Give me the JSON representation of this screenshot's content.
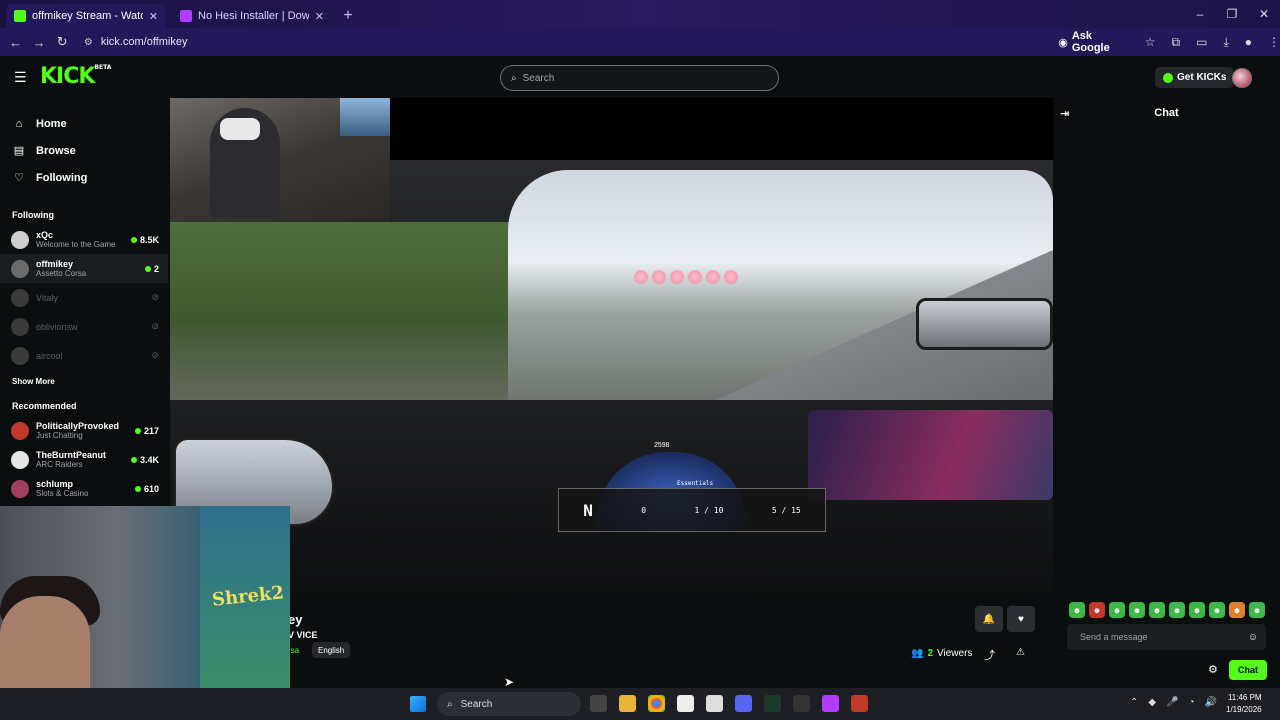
{
  "browser": {
    "tabs": [
      {
        "title": "offmikey Stream - Watch Live o",
        "active": true,
        "favicon_color": "#53fc18"
      },
      {
        "title": "No Hesi Installer | Download N",
        "active": false,
        "favicon_color": "#b03cff"
      }
    ],
    "new_tab": "+",
    "url": "kick.com/offmikey",
    "ask_google": "Ask Google",
    "window_controls": [
      "–",
      "❐",
      "✕"
    ]
  },
  "topnav": {
    "logo": "KICK",
    "logo_badge": "BETA",
    "search_placeholder": "Search",
    "get_kicks": "Get KICKs"
  },
  "sidebar": {
    "nav": [
      {
        "label": "Home",
        "icon": "home-icon"
      },
      {
        "label": "Browse",
        "icon": "browse-icon"
      },
      {
        "label": "Following",
        "icon": "heart-icon"
      }
    ],
    "following_title": "Following",
    "following": [
      {
        "name": "xQc",
        "game": "Welcome to the Game",
        "viewers": "8.5K",
        "live": true,
        "selected": false
      },
      {
        "name": "offmikey",
        "game": "Assetto Corsa",
        "viewers": "2",
        "live": true,
        "selected": true
      },
      {
        "name": "Vitaly",
        "game": "",
        "viewers": "",
        "live": false,
        "selected": false
      },
      {
        "name": "oblivionsw",
        "game": "",
        "viewers": "",
        "live": false,
        "selected": false
      },
      {
        "name": "aircool",
        "game": "",
        "viewers": "",
        "live": false,
        "selected": false
      }
    ],
    "show_more": "Show More",
    "recommended_title": "Recommended",
    "recommended": [
      {
        "name": "PoliticallyProvoked",
        "game": "Just Chatting",
        "viewers": "217"
      },
      {
        "name": "TheBurntPeanut",
        "game": "ARC Raiders",
        "viewers": "3.4K"
      },
      {
        "name": "schlump",
        "game": "Slots & Casino",
        "viewers": "610"
      }
    ]
  },
  "video": {
    "hud": {
      "gear": "N",
      "speed": "0",
      "laps": "1 / 10",
      "position": "5 / 15",
      "rpm_readout": "2598",
      "hud_title": "Essentials"
    }
  },
  "stream_info": {
    "title_fragment": "ey",
    "subtitle_fragment": "V VICE",
    "category_fragment": "rsa",
    "language": "English",
    "viewers_count": "2",
    "viewers_label": "Viewers"
  },
  "chat": {
    "title": "Chat",
    "placeholder": "Send a message",
    "send_label": "Chat",
    "emote_count": 10
  },
  "taskbar": {
    "search_label": "Search",
    "time": "11:46 PM",
    "date": "1/19/2026"
  },
  "colors": {
    "brand": "#53fc18",
    "background": "#0b0e0f"
  }
}
